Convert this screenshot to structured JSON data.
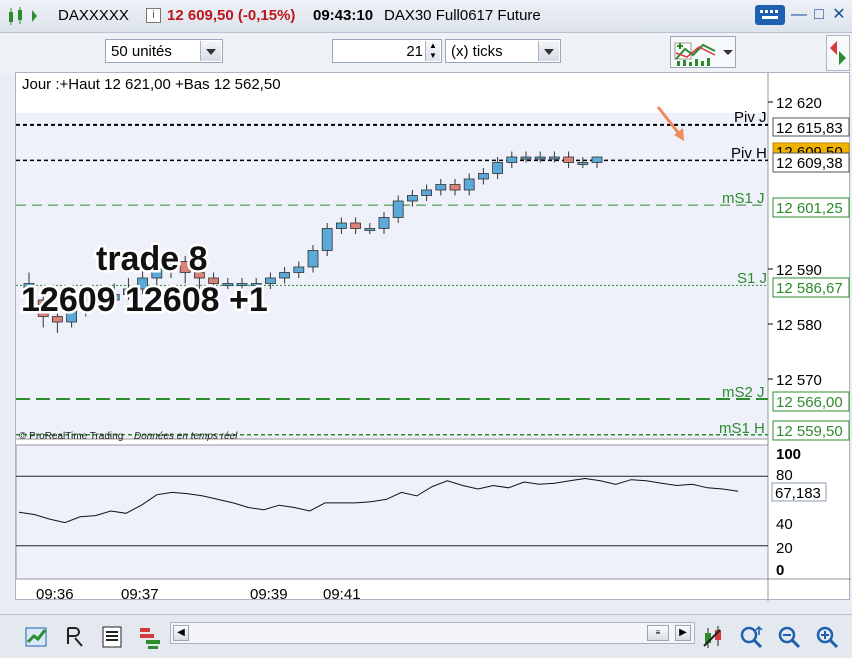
{
  "titlebar": {
    "ticker": "DAXXXXX",
    "info_icon": "info-icon",
    "price_change": "12 609,50 (-0,15%)",
    "time": "09:43:10",
    "instrument": "DAX30 Full0617 Future"
  },
  "toolbar": {
    "units_select": "50 unités",
    "ticks_value": "21",
    "ticks_unit_select": "(x) ticks"
  },
  "chart": {
    "header": "Jour :+Haut 12 621,00 +Bas 12 562,50",
    "overlay_title": "trade 8",
    "overlay_values": "12609 12608 +1",
    "watermark_brand": "© ProRealTime Trading",
    "watermark_note": "Données en temps réel",
    "level_labels": [
      "Piv J",
      "Piv H",
      "mS1 J",
      "S1 J",
      "mS2 J",
      "mS1 H"
    ],
    "price_ticks": [
      "12 620",
      "12 590",
      "12 580",
      "12 570"
    ],
    "price_boxes": [
      "12 615,83",
      "12 609,50",
      "12 609,38",
      "12 601,25",
      "12 586,67",
      "12 566,00",
      "12 559,50"
    ],
    "indicator_ticks": [
      "100",
      "80",
      "40",
      "20",
      "0"
    ],
    "indicator_value": "67,183",
    "time_labels": [
      "09:36",
      "09:37",
      "09:39",
      "09:41"
    ],
    "accent_colors": {
      "up": "#5aa9d6",
      "down": "#d9827a",
      "pivot": "#000000",
      "support": "#2e8b2e",
      "arrow": "#f08a5d",
      "last_price": "#f0b400"
    }
  },
  "chart_data": {
    "type": "candlestick",
    "x_range": [
      "09:36",
      "09:43"
    ],
    "ylim": [
      12557,
      12625
    ],
    "levels": [
      {
        "name": "Piv J",
        "value": 12615.83
      },
      {
        "name": "Piv H",
        "value": 12609.38
      },
      {
        "name": "mS1 J",
        "value": 12601.25
      },
      {
        "name": "S1 J",
        "value": 12586.67
      },
      {
        "name": "mS2 J",
        "value": 12566.0
      },
      {
        "name": "mS1 H",
        "value": 12559.5
      }
    ],
    "last_price": 12609.5,
    "indicator": {
      "ylim": [
        0,
        100
      ],
      "bands": [
        80,
        20
      ],
      "last": 67.183
    }
  },
  "bottombar": {
    "icons": [
      "chart-icon",
      "zoom-in-icon",
      "zoom-out-icon"
    ]
  }
}
